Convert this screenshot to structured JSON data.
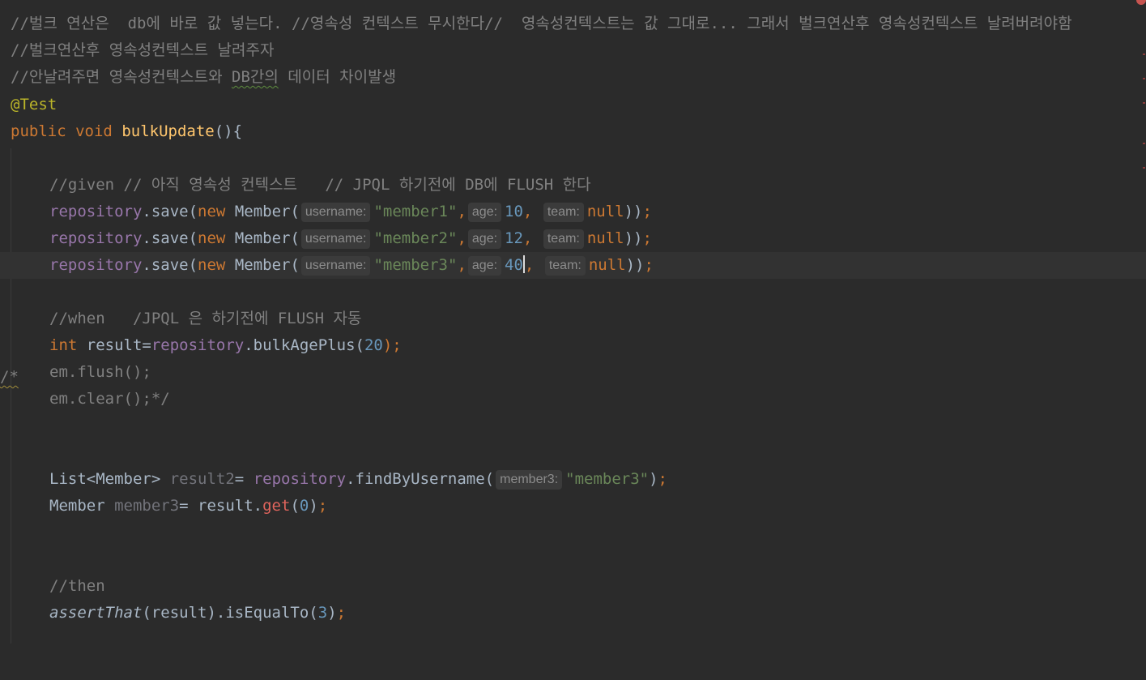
{
  "comments": {
    "bulk_note_1": "//벌크 연산은  db에 바로 값 넣는다. //영속성 컨텍스트 무시한다//  영속성컨텍스트는 값 그대로... 그래서 벌크연산후 영속성컨텍스트 날려버려야함",
    "bulk_note_2": "//벌크연산후 영속성컨텍스트 날려주자",
    "bulk_note_3_pre": "//안날려주면 영속성컨텍스트와 ",
    "bulk_note_3_mark": "DB간의",
    "bulk_note_3_post": " 데이터 차이발생",
    "given": "//given // 아직 영속성 컨텍스트   // JPQL 하기전에 DB에 FLUSH 한다",
    "when": "//when   /JPQL 은 하기전에 FLUSH 자동",
    "then": "//then"
  },
  "annotation": "@Test",
  "method": {
    "public_kw": "public",
    "void_kw": "void",
    "name": "bulkUpdate",
    "open": "(){"
  },
  "save_calls": [
    {
      "receiver": "repository",
      "call": ".save(",
      "new_kw": "new",
      "type": "Member(",
      "hint_username": "username:",
      "username": "\"member1\"",
      "hint_age": "age:",
      "age": "10",
      "hint_team": "team:",
      "team": "null",
      "close": "));"
    },
    {
      "receiver": "repository",
      "call": ".save(",
      "new_kw": "new",
      "type": "Member(",
      "hint_username": "username:",
      "username": "\"member2\"",
      "hint_age": "age:",
      "age": "12",
      "hint_team": "team:",
      "team": "null",
      "close": "));"
    },
    {
      "receiver": "repository",
      "call": ".save(",
      "new_kw": "new",
      "type": "Member(",
      "hint_username": "username:",
      "username": "\"member3\"",
      "hint_age": "age:",
      "age": "40",
      "hint_team": "team:",
      "team": "null",
      "close": "));"
    }
  ],
  "when_block": {
    "int_kw": "int",
    "result_assign": " result=",
    "receiver": "repository",
    "call": ".bulkAgePlus(",
    "arg": "20",
    "close": ");",
    "block_comment_start": "/*",
    "flush_line": "em.flush();",
    "clear_line": "em.clear();*/"
  },
  "find_block": {
    "type": "List<Member> ",
    "var": "result2",
    "assign": "= ",
    "receiver": "repository",
    "call": ".findByUsername(",
    "hint": "member3:",
    "arg": "\"member3\"",
    "close": ");"
  },
  "get_block": {
    "type": "Member ",
    "var": "member3",
    "assign": "= result.",
    "call": "get",
    "open": "(",
    "arg": "0",
    "close": ");"
  },
  "assert_block": {
    "fn": "assertThat",
    "args": "(result).isEqualTo(",
    "arg": "3",
    "close": ");"
  },
  "colors": {
    "background": "#2b2b2b",
    "comment": "#808080",
    "keyword": "#cc7832",
    "string": "#6a8759",
    "number": "#6897bb",
    "field": "#9876aa",
    "method_decl": "#ffc66d",
    "error": "#c75450"
  }
}
